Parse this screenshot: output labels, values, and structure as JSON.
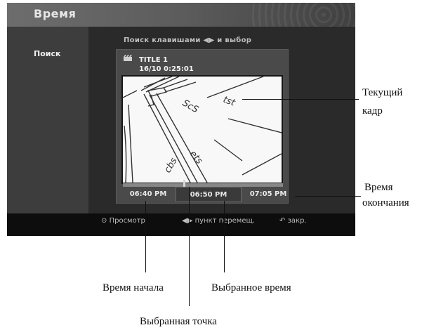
{
  "window": {
    "title": "Время"
  },
  "sidebar": {
    "items": [
      {
        "label": "Поиск"
      }
    ]
  },
  "hint": "Поиск клавишами ◀▶ и выбор",
  "title_info": {
    "name": "TITLE 1",
    "chapter": "16/10",
    "time": "0:25:01"
  },
  "timeline": {
    "start": "06:40 PM",
    "selected": "06:50 PM",
    "end": "07:05 PM",
    "selected_fraction": 0.38
  },
  "footer": {
    "items": [
      {
        "icon": "enter-icon",
        "label": "Просмотр"
      },
      {
        "icon": "left-right-arrows-icon",
        "label": "пункт перемещ."
      },
      {
        "icon": "return-icon",
        "label": "закр."
      }
    ]
  },
  "callouts": {
    "current_frame_line1": "Текущий",
    "current_frame_line2": "кадр",
    "end_time_line1": "Время",
    "end_time_line2": "окончания",
    "start_time": "Время начала",
    "selected_time": "Выбранное время",
    "selected_point": "Выбранная точка"
  }
}
